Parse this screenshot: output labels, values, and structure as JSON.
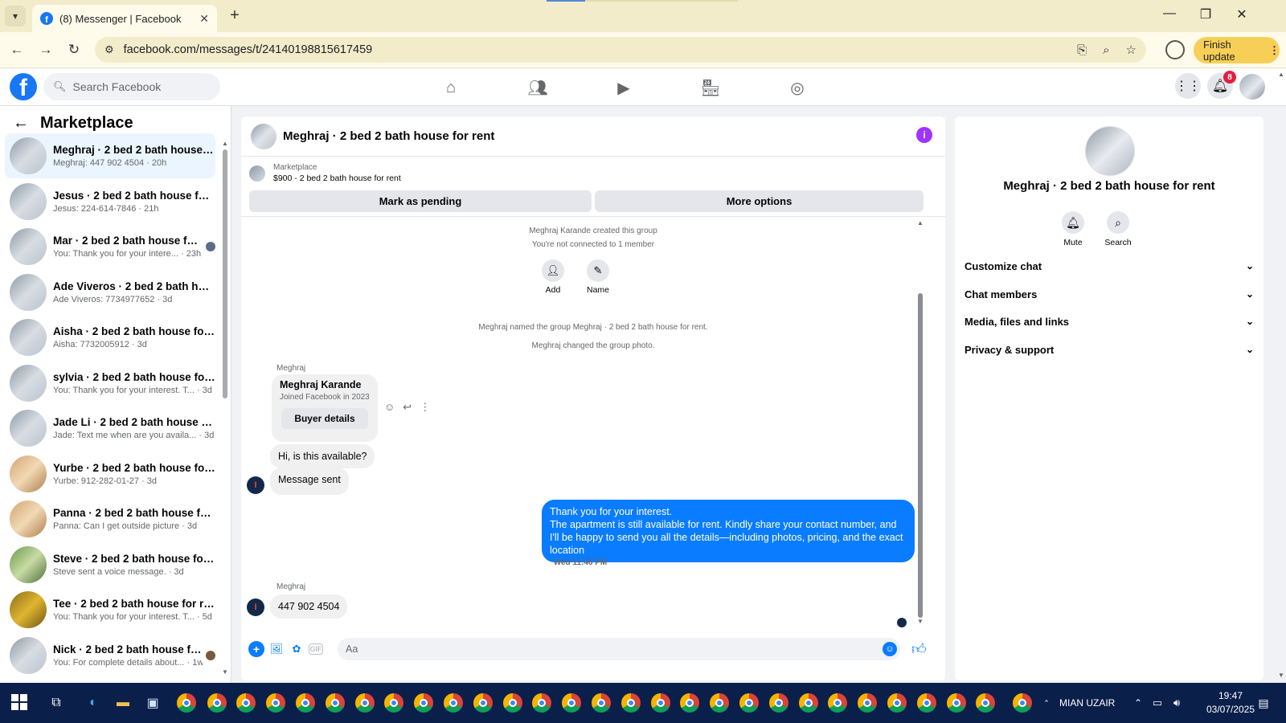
{
  "browser": {
    "tab_title": "(8) Messenger | Facebook",
    "url": "facebook.com/messages/t/24140198815617459",
    "finish_update_label": "Finish update"
  },
  "fb_header": {
    "search_placeholder": "Search Facebook",
    "notification_count": "8"
  },
  "sidebar": {
    "title": "Marketplace",
    "conversations": [
      {
        "name": "Meghraj · 2 bed 2 bath house f...",
        "sub": "Meghraj: 447 902 4504 · 20h"
      },
      {
        "name": "Jesus · 2 bed 2 bath house for r...",
        "sub": "Jesus: 224-614-7846 · 21h"
      },
      {
        "name": "Mar · 2 bed 2 bath house for ...",
        "sub": "You: Thank you for your intere... · 23h"
      },
      {
        "name": "Ade Viveros · 2 bed 2 bath hous...",
        "sub": "Ade Viveros: 7734977652 · 3d"
      },
      {
        "name": "Aisha · 2 bed 2 bath house for r...",
        "sub": "Aisha: 7732005912 · 3d"
      },
      {
        "name": "sylvia · 2 bed 2 bath house for r...",
        "sub": "You: Thank you for your interest. T... · 3d"
      },
      {
        "name": "Jade Li · 2 bed 2 bath house for ...",
        "sub": "Jade: Text me when are you availa... · 3d"
      },
      {
        "name": "Yurbe · 2 bed 2 bath house for r...",
        "sub": "Yurbe: 912-282-01-27 · 3d"
      },
      {
        "name": "Panna · 2 bed 2 bath house for ...",
        "sub": "Panna: Can I get outside picture · 3d"
      },
      {
        "name": "Steve · 2 bed 2 bath house for r...",
        "sub": "Steve sent a voice message. · 3d"
      },
      {
        "name": "Tee · 2 bed 2 bath house for rent",
        "sub": "You: Thank you for your interest. T... · 5d"
      },
      {
        "name": "Nick · 2 bed 2 bath house for ...",
        "sub": "You: For complete details about... · 1w"
      }
    ]
  },
  "chat": {
    "title": "Meghraj · 2 bed 2 bath house for rent",
    "listing_category": "Marketplace",
    "listing_price": "$900 - 2 bed 2 bath house for rent",
    "mark_pending": "Mark as pending",
    "more_options": "More options",
    "sys_created": "Meghraj Karande created this group",
    "sys_not_connected": "You're not connected to 1 member",
    "add_label": "Add",
    "name_label": "Name",
    "sys_named": "Meghraj named the group Meghraj · 2 bed 2 bath house for rent.",
    "sys_photo": "Meghraj changed the group photo.",
    "sender_name": "Meghraj",
    "card_name": "Meghraj Karande",
    "card_sub": "Joined Facebook in 2023",
    "buyer_details": "Buyer details",
    "msg_available": "Hi, is this available?",
    "msg_sent": "Message sent",
    "out_line1": "Thank you for your interest.",
    "out_line2": "The apartment is still available for rent. Kindly share your contact number, and I'll be happy to send you all the details—including photos, pricing, and the exact location",
    "timestamp": "Wed 11:46 PM",
    "msg_phone": "447 902 4504",
    "composer_placeholder": "Aa"
  },
  "details": {
    "title": "Meghraj · 2 bed 2 bath house for rent",
    "mute_label": "Mute",
    "search_label": "Search",
    "rows": [
      "Customize chat",
      "Chat members",
      "Media, files and links",
      "Privacy & support"
    ]
  },
  "taskbar": {
    "user_label": "MIAN UZAIR",
    "time": "19:47",
    "date": "03/07/2025"
  },
  "colors": {
    "fb_blue": "#1877f2",
    "messenger_blue": "#0a7cff",
    "info_purple": "#a033ff",
    "taskbar": "#0b1f4b",
    "finish_update": "#f8cf56"
  }
}
